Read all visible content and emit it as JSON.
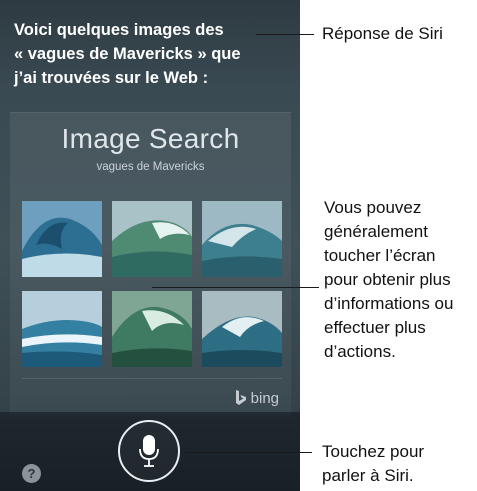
{
  "siri": {
    "response_line1": "Voici quelques images des",
    "response_line2": "« vagues de  Mavericks » que",
    "response_line3": "j’ai trouvées sur le Web :"
  },
  "card": {
    "title": "Image Search",
    "subtitle": "vagues de Mavericks",
    "images": [
      {
        "label": "wave-image-1",
        "tone": "#3d7fa3"
      },
      {
        "label": "wave-image-2",
        "tone": "#4d8a6e"
      },
      {
        "label": "wave-image-3",
        "tone": "#3f7f8f"
      },
      {
        "label": "wave-image-4",
        "tone": "#2f6f93"
      },
      {
        "label": "wave-image-5",
        "tone": "#3e7a62"
      },
      {
        "label": "wave-image-6",
        "tone": "#2e6e85"
      }
    ],
    "provider": "bing"
  },
  "controls": {
    "help_label": "?",
    "mic_icon": "microphone-icon"
  },
  "callouts": {
    "siri_response": "Réponse de Siri",
    "touch_screen_lines": [
      "Vous pouvez",
      "généralement",
      "toucher l’écran",
      "pour obtenir plus",
      "d’informations ou",
      "effectuer plus",
      "d’actions."
    ],
    "talk_lines": [
      "Touchez pour",
      "parler à Siri."
    ]
  },
  "colors": {
    "phone_background": "#3a4a52",
    "text_on_dark": "#ffffff",
    "callout_text": "#111111"
  }
}
